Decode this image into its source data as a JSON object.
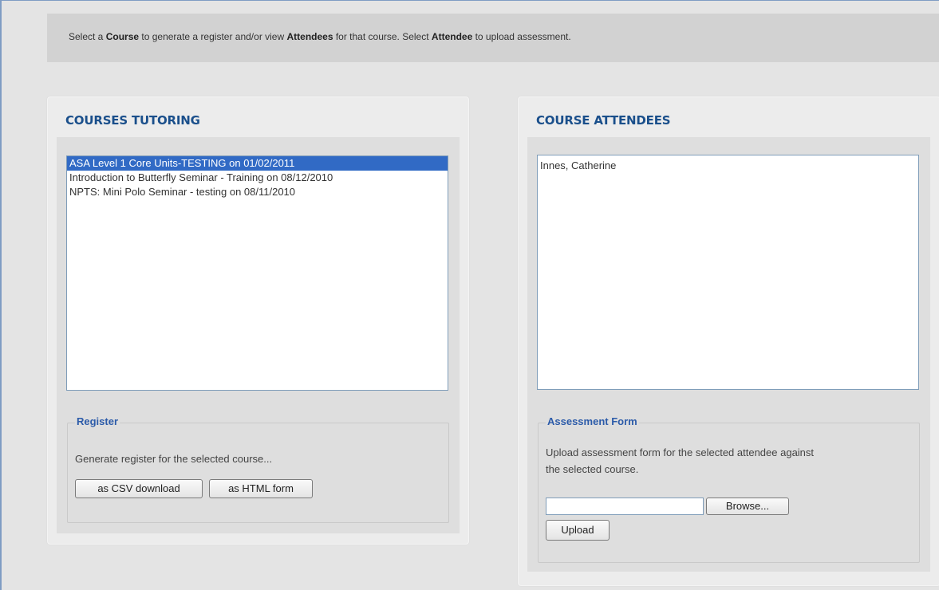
{
  "info": {
    "part1": "Select a ",
    "course_word": "Course",
    "part2": " to generate a register and/or view ",
    "attendees_word": "Attendees",
    "part3": " for that course. Select ",
    "attendee_word": "Attendee",
    "part4": " to upload assessment."
  },
  "courses_panel": {
    "title": "COURSES TUTORING",
    "items": [
      "ASA Level 1 Core Units-TESTING on 01/02/2011",
      "Introduction to Butterfly Seminar - Training on 08/12/2010",
      "NPTS: Mini Polo Seminar - testing on 08/11/2010"
    ],
    "selected_index": 0,
    "register": {
      "legend": "Register",
      "text": "Generate register for the selected course...",
      "csv_button": "as CSV download",
      "html_button": "as HTML form"
    }
  },
  "attendees_panel": {
    "title": "COURSE ATTENDEES",
    "items": [
      "Innes, Catherine"
    ],
    "assessment": {
      "legend": "Assessment Form",
      "text_line1": "Upload assessment form for the selected attendee against",
      "text_line2": "the selected course.",
      "file_value": "",
      "browse_button": "Browse...",
      "upload_button": "Upload"
    }
  },
  "colors": {
    "title": "#1a4f8b",
    "legend": "#2c5ba9",
    "selection": "#316ac5",
    "frame_border": "#7f9cc3"
  }
}
